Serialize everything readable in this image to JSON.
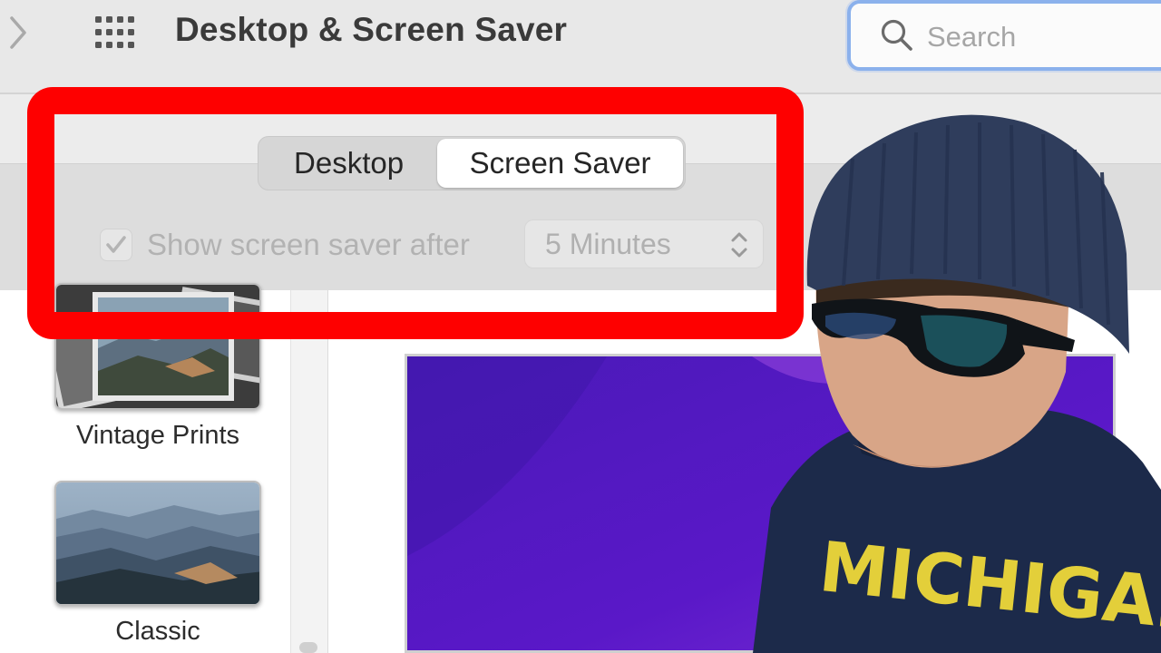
{
  "window": {
    "title": "Desktop & Screen Saver"
  },
  "toolbar": {
    "forward_icon": "chevron-right-icon",
    "grid_icon": "grid-icon"
  },
  "search": {
    "placeholder": "Search",
    "value": "",
    "icon": "search-icon"
  },
  "tabs": [
    {
      "label": "Desktop",
      "selected": false
    },
    {
      "label": "Screen Saver",
      "selected": true
    }
  ],
  "screen_saver": {
    "show_after_label": "Show screen saver after",
    "show_after_checked": true,
    "delay_value": "5 Minutes"
  },
  "sidebar": {
    "items": [
      {
        "label": "Vintage Prints"
      },
      {
        "label": "Classic"
      }
    ]
  },
  "overlay": {
    "shirt_text": "MICHIGAN"
  },
  "colors": {
    "highlight": "#fe0000",
    "search_focus": "#8bb1ec",
    "preview_purple": "#5a18c8"
  }
}
